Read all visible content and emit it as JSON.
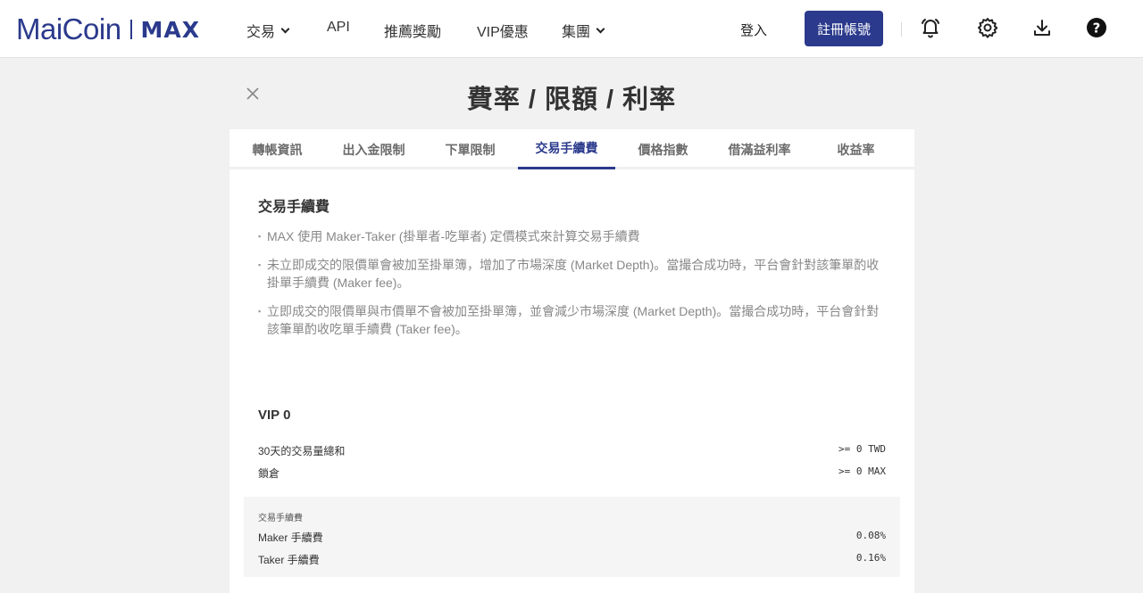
{
  "brand": {
    "name": "MaiCoin",
    "product": "MAX"
  },
  "nav": {
    "items": [
      {
        "label": "交易",
        "dropdown": true
      },
      {
        "label": "API",
        "dropdown": false
      },
      {
        "label": "推薦獎勵",
        "dropdown": false
      },
      {
        "label": "VIP優惠",
        "dropdown": false
      },
      {
        "label": "集團",
        "dropdown": true
      }
    ],
    "login": "登入",
    "register": "註冊帳號",
    "icons": [
      "bell-icon",
      "gear-icon",
      "download-icon",
      "help-icon"
    ]
  },
  "page": {
    "title": "費率 / 限額 / 利率",
    "tabs": [
      "轉帳資訊",
      "出入金限制",
      "下單限制",
      "交易手續費",
      "價格指數",
      "借滿益利率",
      "收益率"
    ],
    "active_tab": "交易手續費"
  },
  "section": {
    "title": "交易手續費",
    "bullets": [
      "MAX 使用 Maker-Taker (掛單者-吃單者) 定價模式來計算交易手續費",
      "未立即成交的限價單會被加至掛單簿，增加了市場深度 (Market Depth)。當撮合成功時，平台會針對該筆單酌收掛單手續費 (Maker fee)。",
      "立即成交的限價單與市價單不會被加至掛單簿，並會減少市場深度 (Market Depth)。當撮合成功時，平台會針對該筆單酌收吃單手續費 (Taker fee)。"
    ]
  },
  "vip": {
    "title": "VIP 0",
    "requirements": [
      {
        "label": "30天的交易量總和",
        "value": ">= 0 TWD"
      },
      {
        "label": "鎖倉",
        "value": ">= 0 MAX"
      }
    ],
    "fees": {
      "caption": "交易手續費",
      "rows": [
        {
          "label": "Maker 手續費",
          "value": "0.08%"
        },
        {
          "label": "Taker 手續費",
          "value": "0.16%"
        }
      ]
    }
  },
  "colors": {
    "brand": "#2b3a8c",
    "background": "#f1f1f1",
    "panel": "#ffffff",
    "fee_box": "#f5f5f5"
  }
}
